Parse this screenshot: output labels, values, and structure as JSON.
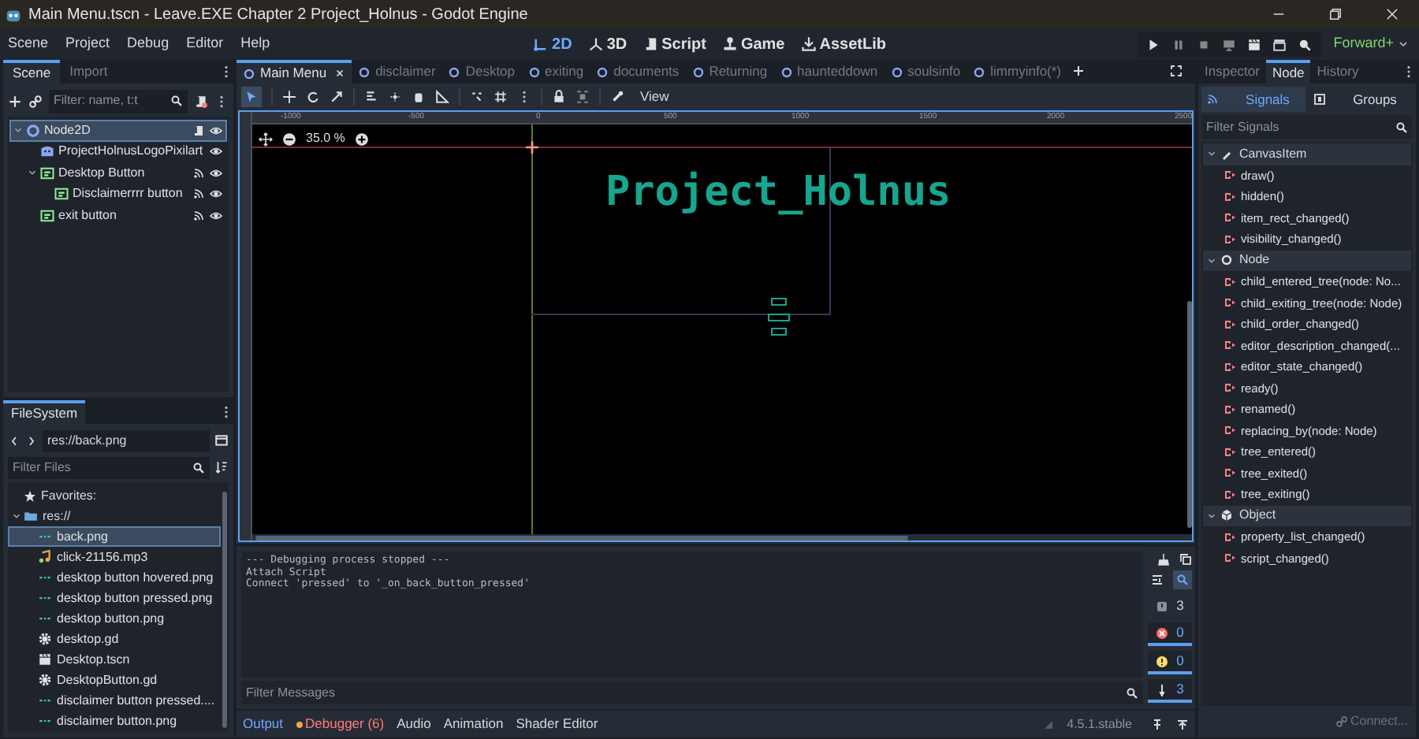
{
  "window": {
    "title": "Main Menu.tscn - Leave.EXE Chapter 2 Project_Holnus - Godot Engine"
  },
  "menu": [
    "Scene",
    "Project",
    "Debug",
    "Editor",
    "Help"
  ],
  "workspaces": [
    {
      "label": "2D",
      "kind": "flat",
      "selected": true
    },
    {
      "label": "3D",
      "kind": "spatial",
      "selected": false
    },
    {
      "label": "Script",
      "kind": "script",
      "selected": false
    },
    {
      "label": "Game",
      "kind": "game",
      "selected": false
    },
    {
      "label": "AssetLib",
      "kind": "assetlib",
      "selected": false
    }
  ],
  "renderer": "Forward+",
  "scene_dock": {
    "tabs": [
      {
        "label": "Scene",
        "selected": true
      },
      {
        "label": "Import",
        "selected": false
      }
    ],
    "filter": {
      "placeholder": "Filter: name, t:t"
    },
    "tree": [
      {
        "name": "Node2D",
        "kind": "node2d",
        "selected": true,
        "expanded": true,
        "script": true,
        "children": [
          {
            "name": "ProjectHolnusLogoPixilart",
            "kind": "sprite",
            "selected": false
          },
          {
            "name": "Desktop Button",
            "kind": "button",
            "selected": false,
            "expanded": true,
            "signals": true,
            "children": [
              {
                "name": "Disclaimerrrr button",
                "kind": "button",
                "selected": false,
                "signals": true
              }
            ]
          },
          {
            "name": "exit button",
            "kind": "button",
            "selected": false,
            "signals": true
          }
        ]
      }
    ]
  },
  "filesystem": {
    "tab": "FileSystem",
    "path": "res://back.png",
    "filter": {
      "placeholder": "Filter Files"
    },
    "favorites": "Favorites:",
    "root": {
      "name": "res://",
      "expanded": true,
      "children": [
        {
          "name": "back.png",
          "kind": "image",
          "selected": true
        },
        {
          "name": "click-21156.mp3",
          "kind": "audio",
          "selected": false
        },
        {
          "name": "desktop button hovered.png",
          "kind": "image",
          "selected": false
        },
        {
          "name": "desktop button pressed.png",
          "kind": "image",
          "selected": false
        },
        {
          "name": "desktop button.png",
          "kind": "image",
          "selected": false
        },
        {
          "name": "desktop.gd",
          "kind": "script",
          "selected": false
        },
        {
          "name": "Desktop.tscn",
          "kind": "scene",
          "selected": false
        },
        {
          "name": "DesktopButton.gd",
          "kind": "script",
          "selected": false
        },
        {
          "name": "disclaimer button pressed....",
          "kind": "image",
          "selected": false
        },
        {
          "name": "disclaimer button.png",
          "kind": "image",
          "selected": false
        }
      ]
    }
  },
  "scene_tabs": [
    {
      "label": "Main Menu",
      "selected": true
    },
    {
      "label": "disclaimer",
      "selected": false
    },
    {
      "label": "Desktop",
      "selected": false
    },
    {
      "label": "exiting",
      "selected": false
    },
    {
      "label": "documents",
      "selected": false
    },
    {
      "label": "Returning",
      "selected": false
    },
    {
      "label": "haunteddown",
      "selected": false
    },
    {
      "label": "soulsinfo",
      "selected": false
    },
    {
      "label": "limmyinfo(*)",
      "selected": false
    }
  ],
  "canvas": {
    "view_menu": "View",
    "zoom": "35.0 %",
    "ruler_labels": [
      "-1000",
      "-500",
      "0",
      "500",
      "1000",
      "1500",
      "2000",
      "2500"
    ],
    "logo_text": "Project_Holnus"
  },
  "output": {
    "lines": [
      "--- Debugging process stopped ---",
      "Attach Script",
      "Connect 'pressed' to '_on_back_button_pressed'"
    ],
    "filter": {
      "placeholder": "Filter Messages"
    },
    "counters": [
      {
        "kind": "messages",
        "count": "3"
      },
      {
        "kind": "errors",
        "count": "0"
      },
      {
        "kind": "warnings",
        "count": "0"
      },
      {
        "kind": "editor",
        "count": "3"
      }
    ]
  },
  "bottom_tabs": [
    {
      "label": "Output",
      "selected": true,
      "alert": false
    },
    {
      "label": "Debugger (6)",
      "selected": false,
      "alert": true
    },
    {
      "label": "Audio",
      "selected": false,
      "alert": false
    },
    {
      "label": "Animation",
      "selected": false,
      "alert": false
    },
    {
      "label": "Shader Editor",
      "selected": false,
      "alert": false
    }
  ],
  "version": "4.5.1.stable",
  "right_dock": {
    "tabs": [
      {
        "label": "Inspector",
        "selected": false
      },
      {
        "label": "Node",
        "selected": true
      },
      {
        "label": "History",
        "selected": false
      }
    ],
    "modes": [
      {
        "label": "Signals",
        "selected": true
      },
      {
        "label": "Groups",
        "selected": false
      }
    ],
    "filter": {
      "placeholder": "Filter Signals"
    },
    "signal_groups": [
      {
        "name": "CanvasItem",
        "kind": "canvasitem",
        "expanded": true,
        "signals": [
          "draw()",
          "hidden()",
          "item_rect_changed()",
          "visibility_changed()"
        ]
      },
      {
        "name": "Node",
        "kind": "node",
        "expanded": true,
        "signals": [
          "child_entered_tree(node: No...",
          "child_exiting_tree(node: Node)",
          "child_order_changed()",
          "editor_description_changed(...",
          "editor_state_changed()",
          "ready()",
          "renamed()",
          "replacing_by(node: Node)",
          "tree_entered()",
          "tree_exited()",
          "tree_exiting()"
        ]
      },
      {
        "name": "Object",
        "kind": "object",
        "expanded": true,
        "signals": [
          "property_list_changed()",
          "script_changed()"
        ]
      }
    ],
    "connect_button": {
      "label": "Connect...",
      "disabled": true
    }
  }
}
